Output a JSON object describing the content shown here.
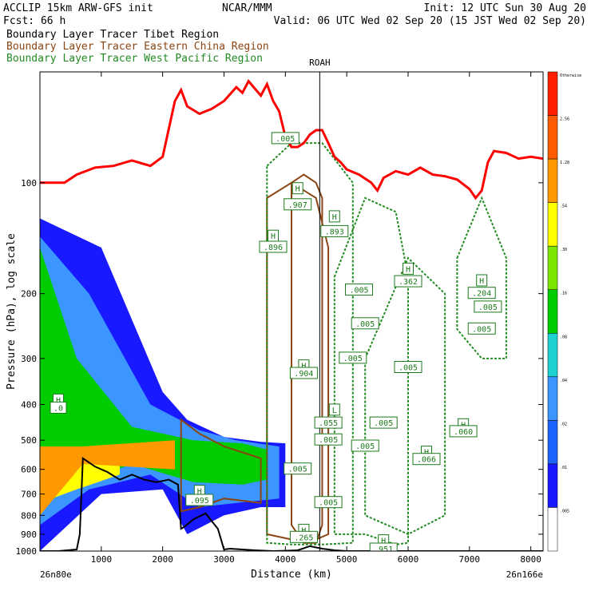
{
  "header": {
    "left1": "ACCLIP 15km ARW-GFS init",
    "left2": "Fcst:   66 h",
    "center": "NCAR/MMM",
    "init": "Init: 12 UTC Sun 30 Aug 20",
    "valid": "Valid: 06 UTC Wed 02 Sep 20 (15 JST Wed 02 Sep 20)"
  },
  "legend": [
    {
      "label": "Boundary Layer Tracer  Tibet Region",
      "color": "#000000"
    },
    {
      "label": "Boundary Layer Tracer  Eastern China Region",
      "color": "#8b4513"
    },
    {
      "label": "Boundary Layer Tracer  West Pacific Region",
      "color": "#228b22"
    }
  ],
  "annotations": {
    "roah": "ROAH",
    "left_point": "26n80e",
    "right_point": "26n166e"
  },
  "chart_data": {
    "type": "area",
    "xlabel": "Distance (km)",
    "ylabel": "Pressure (hPa), log scale",
    "xlim": [
      0,
      8200
    ],
    "ylim": [
      1000,
      50
    ],
    "y_scale": "log",
    "roah_x": 4560,
    "xticks": [
      1000,
      2000,
      3000,
      4000,
      5000,
      6000,
      7000,
      8000
    ],
    "yticks": [
      100,
      200,
      300,
      400,
      500,
      600,
      700,
      800,
      900,
      1000
    ],
    "colorbar": {
      "levels": [
        ".005",
        ".01",
        ".02",
        ".04",
        ".08",
        ".16",
        ".30",
        ".54",
        "1.28",
        "2.56",
        "Otherwise"
      ],
      "colors": [
        "#ffffff",
        "#1919ff",
        "#1e64ff",
        "#3c96ff",
        "#1ed2d2",
        "#00cc00",
        "#7ce600",
        "#ffff00",
        "#ff9900",
        "#ff5a00",
        "#ff2000"
      ]
    },
    "tropopause": {
      "color": "#ff0000",
      "x": [
        0,
        400,
        600,
        900,
        1200,
        1500,
        1800,
        2000,
        2200,
        2300,
        2400,
        2600,
        2800,
        3000,
        3200,
        3300,
        3400,
        3600,
        3700,
        3800,
        3900,
        4000,
        4100,
        4200,
        4300,
        4400,
        4500,
        4600,
        4700,
        4800,
        4900,
        5000,
        5200,
        5400,
        5500,
        5600,
        5800,
        6000,
        6200,
        6400,
        6600,
        6800,
        7000,
        7100,
        7200,
        7300,
        7400,
        7600,
        7800,
        8000,
        8200
      ],
      "y": [
        100,
        100,
        95,
        91,
        90,
        87,
        90,
        85,
        60,
        56,
        62,
        65,
        63,
        60,
        55,
        57,
        53,
        58,
        54,
        60,
        64,
        75,
        80,
        80,
        78,
        74,
        72,
        72,
        78,
        85,
        88,
        92,
        95,
        100,
        105,
        97,
        93,
        95,
        91,
        95,
        96,
        98,
        104,
        110,
        105,
        88,
        82,
        83,
        86,
        85,
        86
      ]
    },
    "terrain": {
      "color": "#000000",
      "x": [
        0,
        300,
        600,
        650,
        700,
        900,
        1100,
        1300,
        1500,
        1700,
        1900,
        2100,
        2250,
        2300,
        2350,
        2500,
        2700,
        2900,
        3000,
        3100,
        3300,
        3500,
        3800,
        4000,
        4200,
        4400,
        4600,
        4800,
        5000,
        6000,
        7000,
        8000,
        8200
      ],
      "y": [
        1000,
        1000,
        990,
        900,
        560,
        590,
        610,
        640,
        620,
        640,
        650,
        640,
        660,
        870,
        860,
        820,
        790,
        870,
        990,
        985,
        990,
        995,
        1000,
        998,
        995,
        970,
        985,
        995,
        1000,
        1000,
        1000,
        1000,
        1000
      ]
    },
    "tibet_tracer": [
      {
        "level": ".01",
        "color": "#1919ff",
        "x": [
          0,
          1000,
          2000,
          2400,
          3000,
          3600,
          4000,
          4000,
          3600,
          3000,
          2400,
          2000,
          1000,
          0
        ],
        "y": [
          125,
          150,
          370,
          440,
          490,
          505,
          510,
          760,
          760,
          800,
          900,
          680,
          700,
          1000
        ]
      },
      {
        "level": ".04",
        "color": "#3c96ff",
        "x": [
          0,
          800,
          1800,
          2600,
          3200,
          3900,
          3900,
          3200,
          2600,
          1800,
          800,
          0
        ],
        "y": [
          140,
          200,
          400,
          470,
          500,
          520,
          720,
          740,
          760,
          620,
          680,
          850
        ]
      },
      {
        "level": ".16",
        "color": "#00cc00",
        "x": [
          0,
          600,
          1500,
          2500,
          3300,
          3700,
          3700,
          3300,
          2500,
          1500,
          600,
          0
        ],
        "y": [
          150,
          300,
          460,
          500,
          510,
          530,
          640,
          660,
          650,
          580,
          660,
          760
        ]
      },
      {
        "level": ".54",
        "color": "#ffff00",
        "x": [
          0,
          600,
          1300,
          1300,
          600,
          0
        ],
        "y": [
          520,
          540,
          560,
          620,
          680,
          740
        ]
      },
      {
        "level": "1.28",
        "color": "#ff9900",
        "x": [
          0,
          700,
          2200,
          2200,
          700,
          0
        ],
        "y": [
          520,
          520,
          500,
          600,
          580,
          800
        ]
      }
    ],
    "china_tracer": [
      {
        "x": [
          4100,
          4300,
          4500,
          4600,
          4600,
          4500,
          4300,
          4100
        ],
        "y": [
          100,
          95,
          100,
          110,
          850,
          950,
          950,
          850
        ]
      },
      {
        "x": [
          3700,
          4100,
          4500,
          4700,
          4700,
          4500,
          4100,
          3700
        ],
        "y": [
          110,
          100,
          110,
          150,
          900,
          930,
          930,
          900
        ]
      },
      {
        "x": [
          2300,
          2600,
          3000,
          3600,
          3600,
          3000,
          2600,
          2300
        ],
        "y": [
          440,
          480,
          520,
          560,
          740,
          720,
          760,
          780
        ]
      }
    ],
    "pacific_tracer": [
      {
        "x": [
          3700,
          4100,
          4600,
          5100,
          5100,
          4600,
          4100,
          3700
        ],
        "y": [
          90,
          78,
          78,
          100,
          950,
          960,
          960,
          950
        ]
      },
      {
        "x": [
          4800,
          5300,
          5800,
          6000,
          6000,
          5800,
          5300,
          4800
        ],
        "y": [
          180,
          110,
          120,
          180,
          950,
          960,
          900,
          900
        ]
      },
      {
        "x": [
          5300,
          6000,
          6600,
          6600,
          6000,
          5300
        ],
        "y": [
          300,
          160,
          200,
          800,
          900,
          800
        ]
      },
      {
        "x": [
          6800,
          7200,
          7600,
          7600,
          7200,
          6800
        ],
        "y": [
          160,
          110,
          160,
          300,
          300,
          250
        ]
      }
    ],
    "labels": [
      {
        "text": ".005",
        "x": 4000,
        "y": 76
      },
      {
        "text": "H",
        "x": 4200,
        "y": 104
      },
      {
        "text": ".907",
        "x": 4200,
        "y": 115
      },
      {
        "text": "H",
        "x": 4800,
        "y": 124
      },
      {
        "text": ".893",
        "x": 4800,
        "y": 136
      },
      {
        "text": "H",
        "x": 3800,
        "y": 140
      },
      {
        "text": ".896",
        "x": 3800,
        "y": 150
      },
      {
        "text": "H",
        "x": 6000,
        "y": 172
      },
      {
        "text": ".362",
        "x": 6000,
        "y": 186
      },
      {
        "text": "H",
        "x": 7200,
        "y": 185
      },
      {
        "text": ".204",
        "x": 7200,
        "y": 200
      },
      {
        "text": ".005",
        "x": 5200,
        "y": 196
      },
      {
        "text": ".005",
        "x": 7300,
        "y": 218
      },
      {
        "text": ".005",
        "x": 5300,
        "y": 242
      },
      {
        "text": ".005",
        "x": 7200,
        "y": 250
      },
      {
        "text": ".005",
        "x": 5100,
        "y": 300
      },
      {
        "text": ".005",
        "x": 6000,
        "y": 318
      },
      {
        "text": "H",
        "x": 4300,
        "y": 315
      },
      {
        "text": ".904",
        "x": 4300,
        "y": 330
      },
      {
        "text": "H",
        "x": 300,
        "y": 390
      },
      {
        "text": ".0",
        "x": 300,
        "y": 410
      },
      {
        "text": "L",
        "x": 4800,
        "y": 415
      },
      {
        "text": ".055",
        "x": 4700,
        "y": 450
      },
      {
        "text": ".005",
        "x": 5600,
        "y": 450
      },
      {
        "text": "H",
        "x": 6900,
        "y": 455
      },
      {
        "text": ".060",
        "x": 6900,
        "y": 475
      },
      {
        "text": ".005",
        "x": 4700,
        "y": 500
      },
      {
        "text": ".005",
        "x": 5300,
        "y": 520
      },
      {
        "text": "H",
        "x": 6300,
        "y": 540
      },
      {
        "text": ".066",
        "x": 6300,
        "y": 565
      },
      {
        "text": ".005",
        "x": 4200,
        "y": 600
      },
      {
        "text": ".005",
        "x": 4700,
        "y": 740
      },
      {
        "text": "H",
        "x": 2600,
        "y": 690
      },
      {
        "text": ".095",
        "x": 2600,
        "y": 730
      },
      {
        "text": "H",
        "x": 4300,
        "y": 880
      },
      {
        "text": ".265",
        "x": 4300,
        "y": 920
      },
      {
        "text": "H",
        "x": 5600,
        "y": 940
      },
      {
        "text": ".951",
        "x": 5600,
        "y": 990
      }
    ]
  }
}
